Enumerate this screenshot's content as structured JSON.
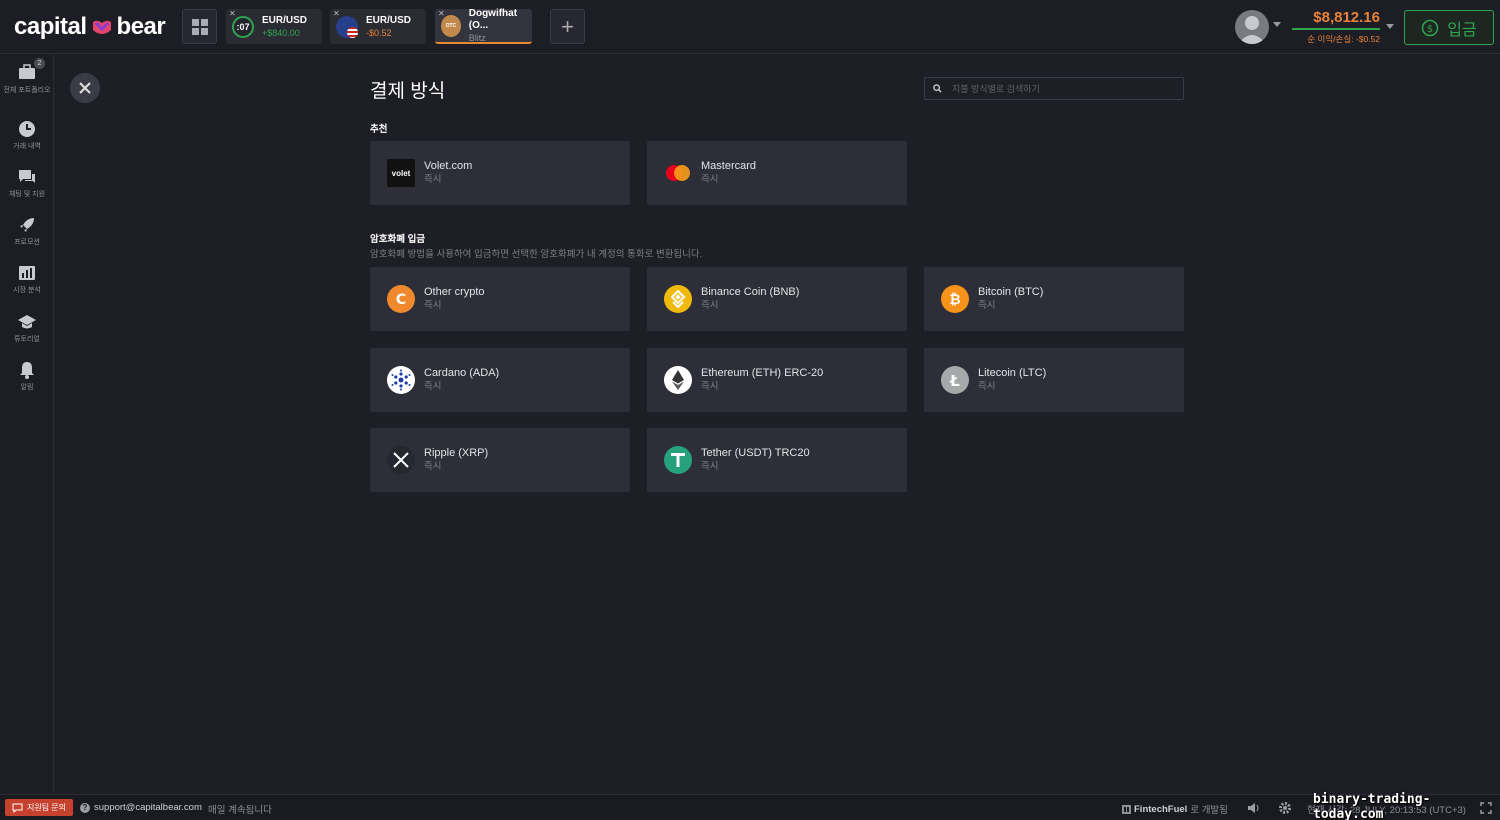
{
  "brand": {
    "name_left": "capital",
    "name_right": "bear"
  },
  "tabs": [
    {
      "timer": ":07",
      "asset": "EUR/USD",
      "pnl": "+$840.00",
      "pnl_color": "#2fa44f"
    },
    {
      "asset": "EUR/USD",
      "pnl": "-$0.52",
      "pnl_color": "#e8813a"
    },
    {
      "asset": "Dogwifhat (O...",
      "sub": "Blitz",
      "icon_text": "OTC"
    }
  ],
  "account": {
    "balance": "$8,812.16",
    "pnl_label": "순 이익/손실: -$0.52",
    "deposit_label": "입금"
  },
  "sidebar": {
    "portfolio_badge": "2",
    "items": [
      {
        "label": "전체 포트폴리오"
      },
      {
        "label": "거래 내역"
      },
      {
        "label": "채팅 및 지원"
      },
      {
        "label": "프로모션"
      },
      {
        "label": "시장 분석"
      },
      {
        "label": "튜토리얼"
      },
      {
        "label": "알림"
      }
    ]
  },
  "main": {
    "title": "결제 방식",
    "search_placeholder": "지불 방식별로 검색하기",
    "recommended_title": "추천",
    "crypto_title": "암호화폐 입금",
    "crypto_desc": "암호화폐 방법을 사용하여 입금하면 선택한 암호화폐가 내 계정의 통화로 변환됩니다.",
    "recommended": [
      {
        "name": "Volet.com",
        "sub": "즉시",
        "icon_text": "volet"
      },
      {
        "name": "Mastercard",
        "sub": "즉시"
      }
    ],
    "crypto": [
      {
        "name": "Other crypto",
        "sub": "즉시",
        "color": "#f0882d"
      },
      {
        "name": "Binance Coin (BNB)",
        "sub": "즉시",
        "color": "#f0b90b"
      },
      {
        "name": "Bitcoin (BTC)",
        "sub": "즉시",
        "color": "#f7931a"
      },
      {
        "name": "Cardano (ADA)",
        "sub": "즉시",
        "color": "#ffffff"
      },
      {
        "name": "Ethereum (ETH) ERC-20",
        "sub": "즉시",
        "color": "#ffffff"
      },
      {
        "name": "Litecoin (LTC)",
        "sub": "즉시",
        "color": "#a6a9aa"
      },
      {
        "name": "Ripple (XRP)",
        "sub": "즉시",
        "color": "#23292f"
      },
      {
        "name": "Tether (USDT) TRC20",
        "sub": "즉시",
        "color": "#26a17b"
      }
    ]
  },
  "footer": {
    "help_label": "지원팀 문의",
    "support_email": "support@capitalbear.com",
    "open_text": "매일 계속됩니다",
    "dev_brand": "FintechFuel",
    "dev_suffix": "로 개발됨",
    "clock": "현재 시간: 28 JULY, 20:13:53 (UTC+3)"
  },
  "watermark": "binary-trading-today.com"
}
